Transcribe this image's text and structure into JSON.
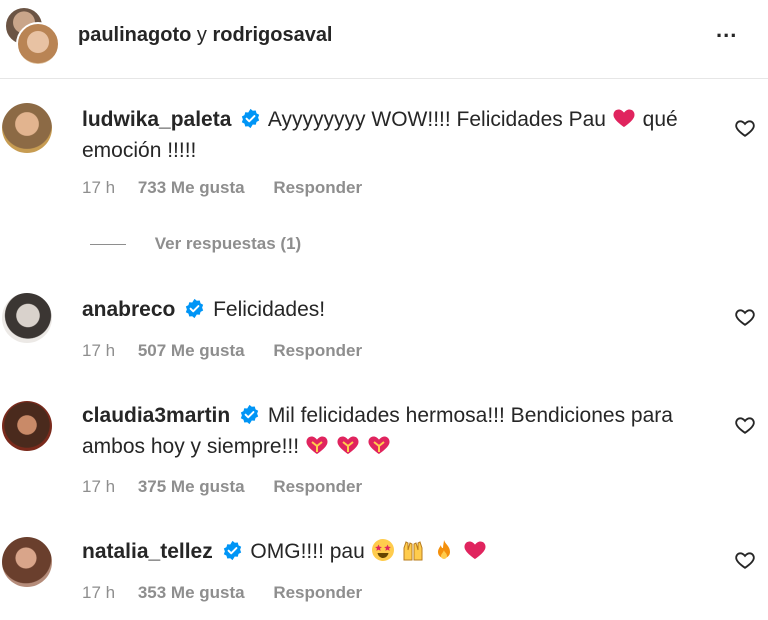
{
  "header": {
    "user1": "paulinagoto",
    "conjunction": "y",
    "user2": "rodrigosaval",
    "more_label": "..."
  },
  "comments": [
    {
      "username": "ludwika_paleta",
      "text_a": "Ayyyyyyyy WOW!!!! Felicidades Pau",
      "text_b": "qué emoción !!!!!",
      "time": "17 h",
      "likes": "733 Me gusta",
      "reply": "Responder"
    },
    {
      "username": "anabreco",
      "text_a": "Felicidades!",
      "time": "17 h",
      "likes": "507 Me gusta",
      "reply": "Responder"
    },
    {
      "username": "claudia3martin",
      "text_a": "Mil felicidades hermosa!!! Bendiciones para ambos hoy y siempre!!!",
      "time": "17 h",
      "likes": "375 Me gusta",
      "reply": "Responder"
    },
    {
      "username": "natalia_tellez",
      "text_a": "OMG!!!! pau",
      "time": "17 h",
      "likes": "353 Me gusta",
      "reply": "Responder"
    }
  ],
  "view_replies": "Ver respuestas (1)",
  "icons": {
    "verified": "verified-badge-icon",
    "like": "heart-outline-icon",
    "more": "more-options-icon"
  },
  "colors": {
    "verified_blue": "#0095f6",
    "muted_text": "#8e8e8e",
    "heart_red": "#e0245e"
  }
}
